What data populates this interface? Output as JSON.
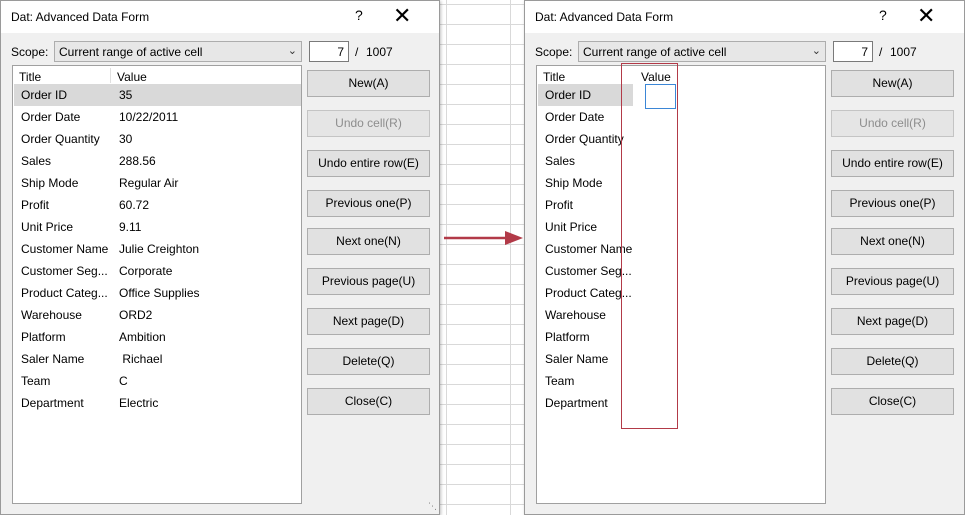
{
  "dialog": {
    "title": "Dat: Advanced Data Form",
    "help_label": "?",
    "close_label": "✕",
    "scope_label": "Scope:",
    "scope_value": "Current range of active cell",
    "record_current": "7",
    "record_separator": "/",
    "record_total": "1007",
    "column_title": "Title",
    "column_value": "Value"
  },
  "fields": [
    {
      "title": "Order ID",
      "value": "35"
    },
    {
      "title": "Order Date",
      "value": "10/22/2011"
    },
    {
      "title": "Order Quantity",
      "value": "30"
    },
    {
      "title": "Sales",
      "value": "288.56"
    },
    {
      "title": "Ship Mode",
      "value": "Regular Air"
    },
    {
      "title": "Profit",
      "value": "60.72"
    },
    {
      "title": "Unit Price",
      "value": "9.11"
    },
    {
      "title": "Customer Name",
      "value": "Julie Creighton"
    },
    {
      "title": "Customer Seg...",
      "value": "Corporate"
    },
    {
      "title": "Product Categ...",
      "value": "Office Supplies"
    },
    {
      "title": "Warehouse",
      "value": "ORD2"
    },
    {
      "title": "Platform",
      "value": "Ambition"
    },
    {
      "title": "Saler Name",
      "value": " Richael"
    },
    {
      "title": "Team",
      "value": "C"
    },
    {
      "title": "Department",
      "value": "Electric"
    }
  ],
  "buttons": {
    "new": "New(A)",
    "undo_cell": "Undo cell(R)",
    "undo_row": "Undo entire row(E)",
    "previous_one": "Previous one(P)",
    "next_one": "Next one(N)",
    "previous_page": "Previous page(U)",
    "next_page": "Next page(D)",
    "delete": "Delete(Q)",
    "close": "Close(C)"
  },
  "colors": {
    "highlight_box": "#b23a48",
    "arrow": "#b23a48",
    "edit_border": "#3b86d6"
  }
}
